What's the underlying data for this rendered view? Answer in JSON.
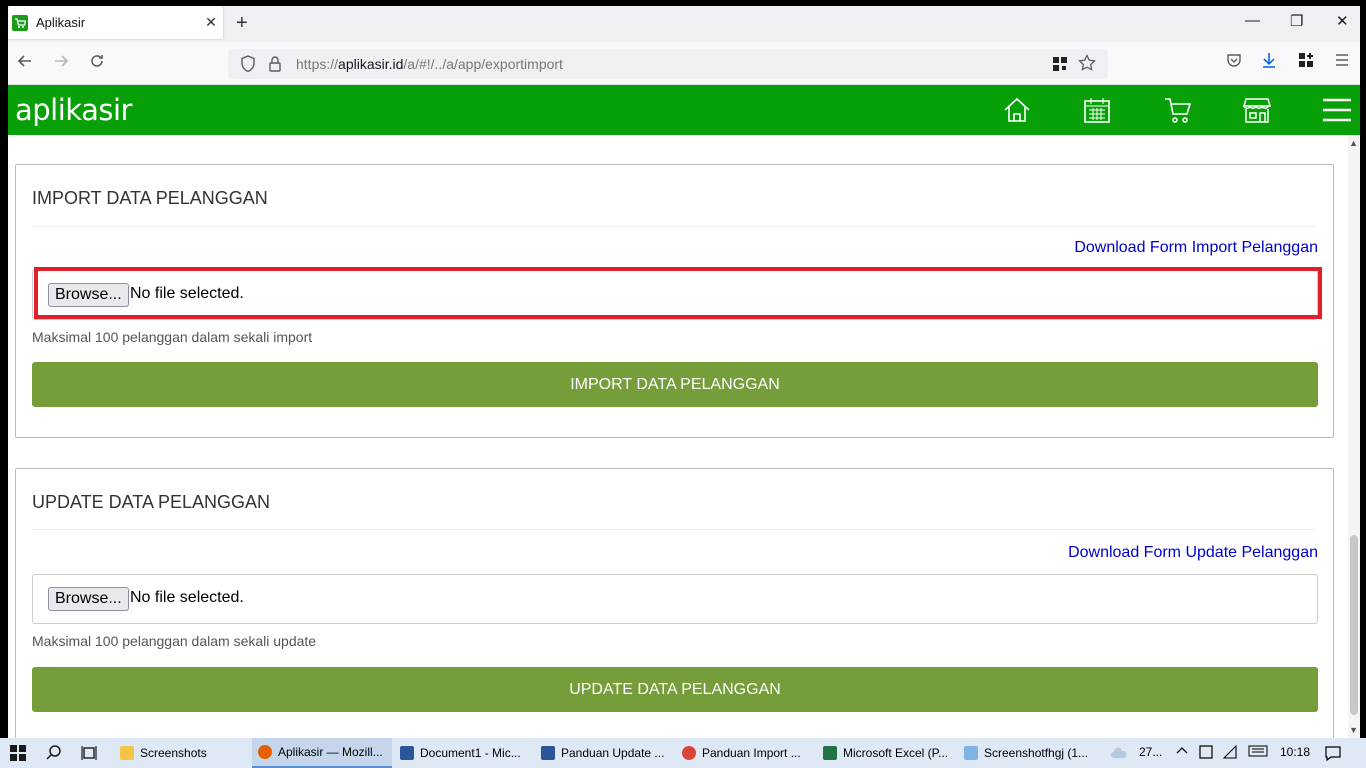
{
  "browser": {
    "tab_title": "Aplikasir",
    "tab_close": "✕",
    "new_tab": "+",
    "url_prefix": "https://",
    "url_domain": "aplikasir.id",
    "url_path": "/a/#!/../a/app/exportimport",
    "window_minimize": "—",
    "window_restore": "❐",
    "window_close": "✕"
  },
  "app": {
    "logo": "aplikasir",
    "brand_color": "#08a008",
    "nav_icons": [
      "home-icon",
      "calendar-icon",
      "cart-icon",
      "store-icon",
      "menu-icon"
    ]
  },
  "import_panel": {
    "title": "IMPORT DATA PELANGGAN",
    "download_link": "Download Form Import Pelanggan",
    "browse_label": "Browse...",
    "file_status": "No file selected.",
    "hint": "Maksimal 100 pelanggan dalam sekali import",
    "button_label": "IMPORT DATA PELANGGAN"
  },
  "update_panel": {
    "title": "UPDATE DATA PELANGGAN",
    "download_link": "Download Form Update Pelanggan",
    "browse_label": "Browse...",
    "file_status": "No file selected.",
    "hint": "Maksimal 100 pelanggan dalam sekali update",
    "button_label": "UPDATE DATA PELANGGAN"
  },
  "colors": {
    "action_button": "#759d39",
    "highlight": "#e0202a",
    "link": "#0000cc"
  },
  "taskbar": {
    "items": [
      {
        "label": "Screenshots",
        "icon": "folder-icon"
      },
      {
        "label": "Aplikasir — Mozill...",
        "icon": "firefox-icon"
      },
      {
        "label": "Document1 - Mic...",
        "icon": "word-icon"
      },
      {
        "label": "Panduan Update ...",
        "icon": "word-icon"
      },
      {
        "label": "Panduan Import ...",
        "icon": "chrome-icon"
      },
      {
        "label": "Microsoft Excel (P...",
        "icon": "excel-icon"
      },
      {
        "label": "Screenshotfhgj (1...",
        "icon": "paint-icon"
      }
    ],
    "weather": "27...",
    "time": "10:18"
  }
}
